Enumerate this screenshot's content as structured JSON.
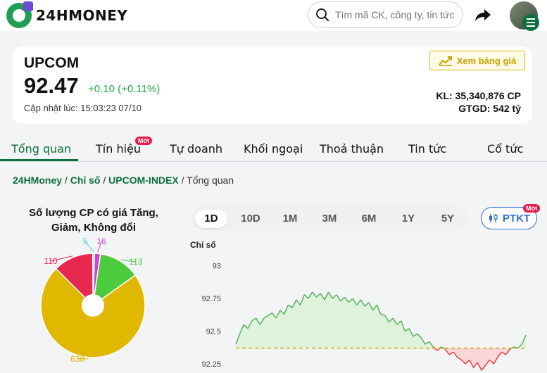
{
  "header": {
    "logo_text": "24HMONEY",
    "search_placeholder": "Tìm mã CK, công ty, tin tức"
  },
  "index": {
    "name": "UPCOM",
    "value": "92.47",
    "change": "+0.10 (+0.11%)",
    "updated": "Cập nhật lúc: 15:03:23 07/10",
    "view_board_label": "Xem bảng giá",
    "kl": "KL: 35,340,876 CP",
    "gtgd": "GTGD: 542 tỷ",
    "change_color": "#22a74a"
  },
  "tabs": [
    {
      "label": "Tổng quan",
      "active": true
    },
    {
      "label": "Tín hiệu",
      "badge": "Mới"
    },
    {
      "label": "Tự doanh"
    },
    {
      "label": "Khối ngoại"
    },
    {
      "label": "Thoả thuận"
    },
    {
      "label": "Tin tức"
    },
    {
      "label": "Cổ tức"
    }
  ],
  "breadcrumb": {
    "home": "24HMoney",
    "section": "Chỉ số",
    "index": "UPCOM-INDEX",
    "current": "Tổng quan",
    "sep": "/"
  },
  "pie": {
    "title_line1": "Số lượng CP có giá Tăng,",
    "title_line2": "Giảm, Không đổi"
  },
  "range": {
    "options": [
      "1D",
      "10D",
      "1M",
      "3M",
      "6M",
      "1Y",
      "5Y"
    ],
    "selected": "1D",
    "ptkt_label": "PTKT",
    "ptkt_badge": "Mới"
  },
  "chart_data": [
    {
      "type": "pie",
      "title": "Số lượng CP có giá Tăng, Giảm, Không đổi",
      "slices": [
        {
          "value": 638,
          "color": "#e0b800"
        },
        {
          "value": 110,
          "color": "#e8294f"
        },
        {
          "value": 5,
          "color": "#3fd0d8"
        },
        {
          "value": 16,
          "color": "#d63ed6"
        },
        {
          "value": 113,
          "color": "#4ccc3c"
        }
      ]
    },
    {
      "type": "area",
      "ylabel": "Chỉ số",
      "yticks": [
        93,
        92.75,
        92.5,
        92.25
      ],
      "ylim": [
        92.18,
        93.02
      ],
      "reference": 92.37,
      "values": [
        92.4,
        92.48,
        92.55,
        92.52,
        92.58,
        92.6,
        92.55,
        92.6,
        92.62,
        92.64,
        92.6,
        92.66,
        92.63,
        92.7,
        92.68,
        92.74,
        92.7,
        92.78,
        92.75,
        92.8,
        92.76,
        92.79,
        92.74,
        92.8,
        92.75,
        92.78,
        92.73,
        92.76,
        92.72,
        92.75,
        92.7,
        92.74,
        92.69,
        92.72,
        92.66,
        92.7,
        92.63,
        92.62,
        92.57,
        92.6,
        92.55,
        92.58,
        92.5,
        92.52,
        92.46,
        92.48,
        92.45,
        92.4,
        92.42,
        92.38,
        92.35,
        92.38,
        92.36,
        92.32,
        92.34,
        92.3,
        92.28,
        92.25,
        92.28,
        92.22,
        92.26,
        92.2,
        92.24,
        92.28,
        92.25,
        92.3,
        92.34,
        92.32,
        92.36,
        92.38,
        92.37,
        92.4,
        92.47
      ],
      "up_color": "#4caf50",
      "down_color": "#e53935"
    }
  ]
}
